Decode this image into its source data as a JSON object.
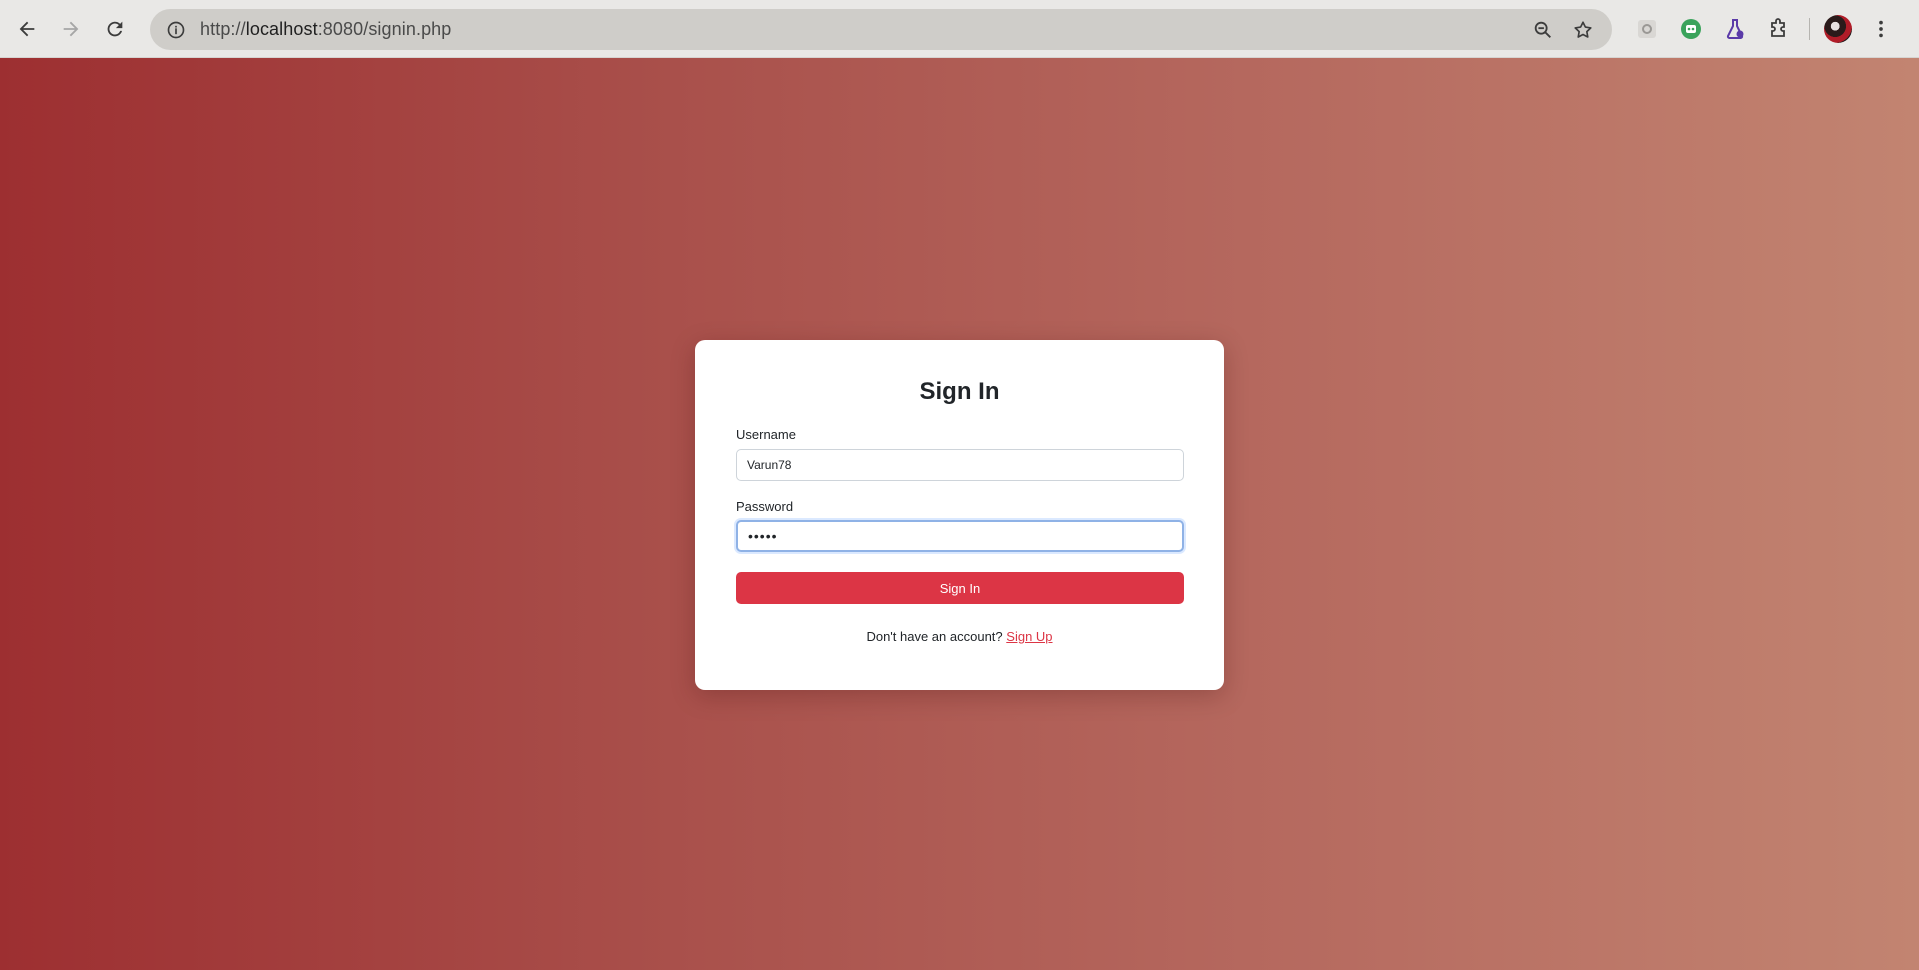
{
  "browser": {
    "url_scheme": "http://",
    "url_host": "localhost",
    "url_rest": ":8080/signin.php"
  },
  "form": {
    "title": "Sign In",
    "username_label": "Username",
    "username_value": "Varun78",
    "password_label": "Password",
    "password_value": "•••••",
    "submit_label": "Sign In",
    "signup_prompt": "Don't have an account?",
    "signup_link": "Sign Up"
  },
  "colors": {
    "accent": "#dc3545",
    "background_start": "#9d2f31",
    "background_end": "#c28471"
  }
}
